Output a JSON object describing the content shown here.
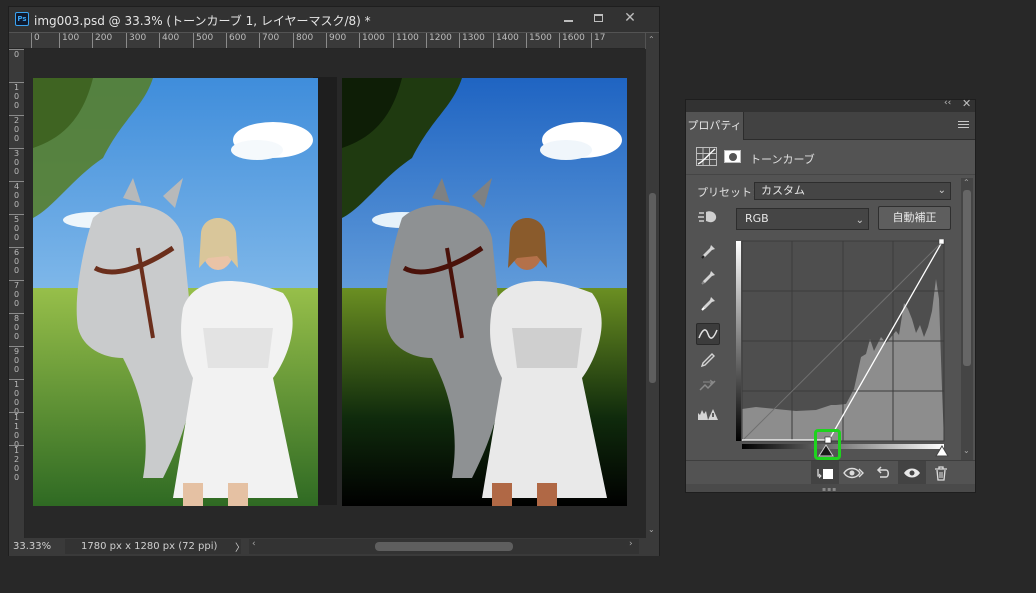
{
  "document": {
    "title": "img003.psd @ 33.3% (トーンカーブ 1, レイヤーマスク/8) *",
    "app_icon": "Ps",
    "ruler_h": [
      "0",
      "100",
      "200",
      "300",
      "400",
      "500",
      "600",
      "700",
      "800",
      "900",
      "1000",
      "1100",
      "1200",
      "1300",
      "1400",
      "1500",
      "1600",
      "17"
    ],
    "ruler_v": [
      "0",
      "1\n0\n0",
      "2\n0\n0",
      "3\n0\n0",
      "4\n0\n0",
      "5\n0\n0",
      "6\n0\n0",
      "7\n0\n0",
      "8\n0\n0",
      "9\n0\n0",
      "1\n0\n0\n0",
      "1\n1\n0\n0",
      "1\n2\n0\n0"
    ],
    "zoom": "33.33%",
    "doc_info": "1780 px x 1280 px (72 ppi)",
    "status_arrow": "〉",
    "photo_left_name": "original-photo",
    "photo_right_name": "adjusted-photo"
  },
  "window_controls": {
    "minimize": "minimize-icon",
    "maximize": "maximize-icon",
    "close": "✕"
  },
  "panel": {
    "collapse": "‹‹",
    "close": "✕",
    "tab": "プロパティ",
    "adjustment_label": "トーンカーブ",
    "preset_label": "プリセット：",
    "preset_value": "カスタム",
    "channel_value": "RGB",
    "auto_button": "自動補正",
    "tools": [
      "eyedropper-black-icon",
      "eyedropper-gray-icon",
      "eyedropper-white-icon",
      "curve-point-icon",
      "pencil-icon",
      "smooth-icon",
      "clipping-warning-icon"
    ],
    "bottom_buttons": [
      "clip-to-layer-icon",
      "view-previous-icon",
      "reset-icon",
      "visibility-icon",
      "trash-icon"
    ]
  },
  "curve": {
    "points": [
      [
        0,
        0
      ],
      [
        88,
        0
      ],
      [
        255,
        255
      ]
    ],
    "channel": "RGB",
    "selected_point_input": 88,
    "histogram_hint": "shadows-low, highlights-peak"
  },
  "colors": {
    "highlight": "#1ed31e",
    "panel_bg": "#535353",
    "app_bg": "#282828"
  }
}
